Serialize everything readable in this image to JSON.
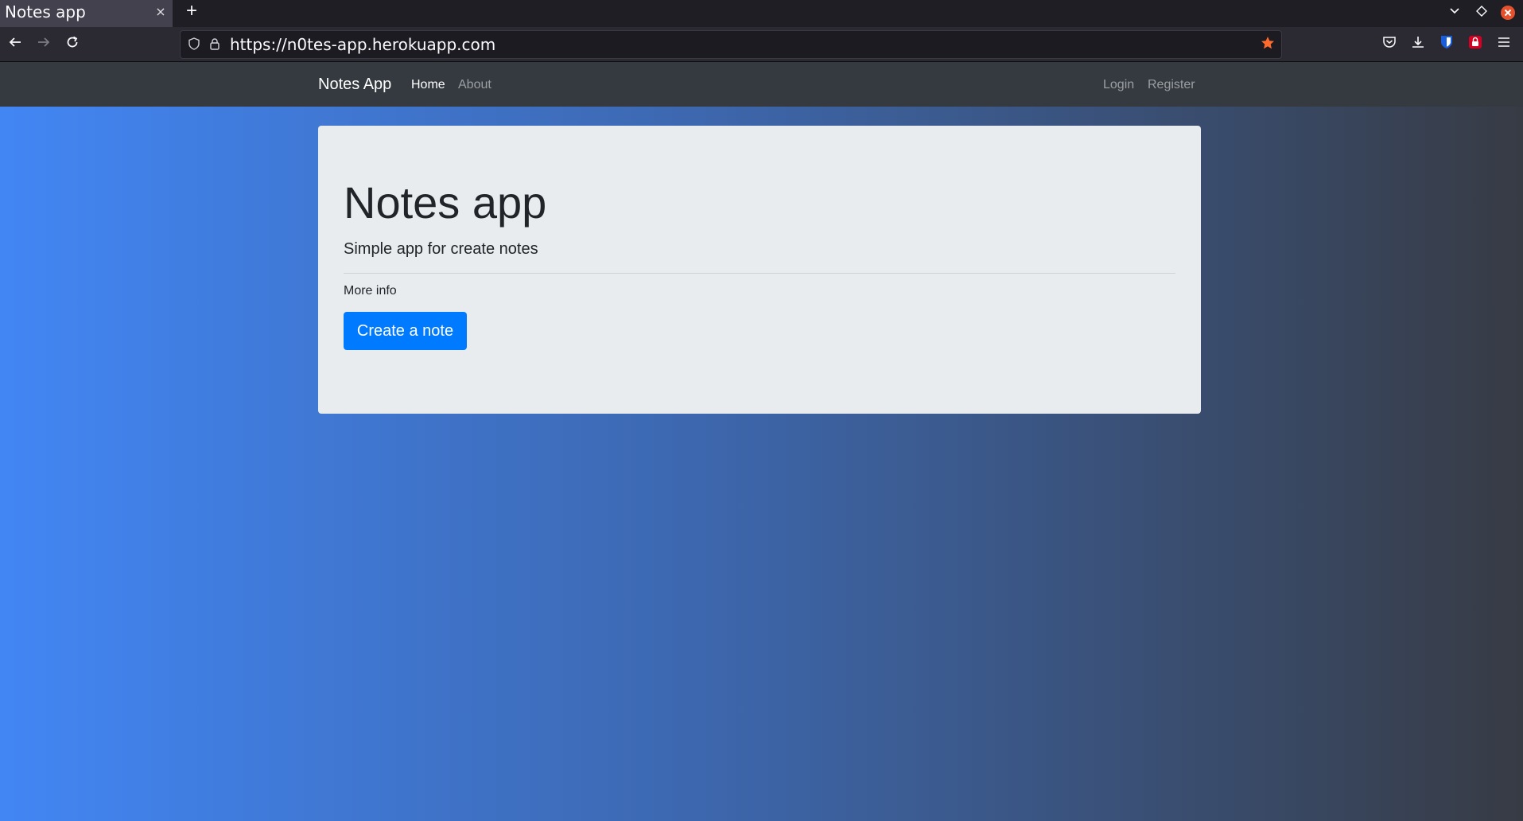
{
  "browser": {
    "tab_title": "Notes app",
    "tab_close": "×",
    "new_tab": "+",
    "url": "https://n0tes-app.herokuapp.com",
    "icons": [
      "back-arrow-icon",
      "forward-arrow-icon",
      "reload-icon",
      "shield-icon",
      "lock-icon",
      "star-icon",
      "pocket-icon",
      "download-icon",
      "bitwarden-icon",
      "extension-icon",
      "menu-icon",
      "tab-list-chevron-icon",
      "extensions-diamond-icon",
      "close-window-icon"
    ],
    "bookmark_color": "#ff6b2c"
  },
  "site": {
    "brand": "Notes App",
    "nav": {
      "home": "Home",
      "about": "About",
      "login": "Login",
      "register": "Register"
    },
    "colors": {
      "navbar": "#343a40",
      "gradient_start": "#4286f4",
      "gradient_end": "#373b44",
      "primary": "#007bff"
    }
  },
  "hero": {
    "title": "Notes app",
    "lead": "Simple app for create notes",
    "more": "More info",
    "button": "Create a note"
  }
}
